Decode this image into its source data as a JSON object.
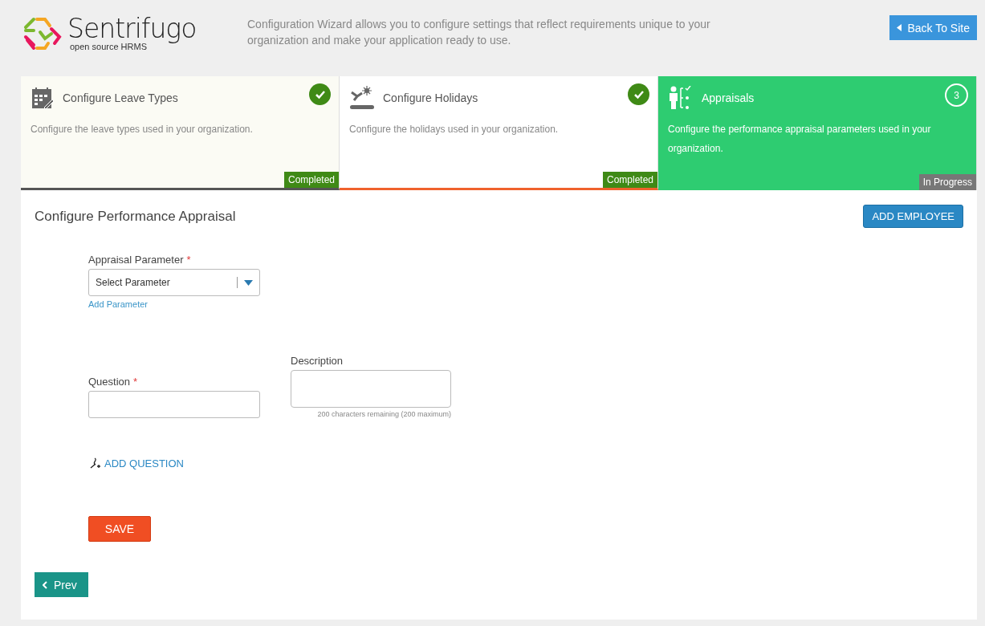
{
  "header": {
    "logo_name": "Sentrifugo",
    "logo_tagline": "open source HRMS",
    "intro": "Configuration Wizard allows you to configure settings that reflect requirements unique to your organization and make your application ready to use.",
    "back_button": "Back To Site"
  },
  "steps": [
    {
      "title": "Configure Leave Types",
      "description": "Configure the leave types used in your organization.",
      "status": "Completed",
      "kind": "completed",
      "color": "#555555",
      "selected": false
    },
    {
      "title": "Configure Holidays",
      "description": "Configure the holidays used in your organization.",
      "status": "Completed",
      "kind": "completed",
      "color": "#f0622d",
      "selected": false
    },
    {
      "title": "Appraisals",
      "description": "Configure the performance appraisal parameters used in your organization.",
      "status": "In Progress",
      "kind": "in_progress",
      "number": "3",
      "selected": true
    }
  ],
  "form": {
    "title": "Configure Performance Appraisal",
    "add_employee_button": "ADD EMPLOYEE",
    "parameter": {
      "label": "Appraisal Parameter",
      "required_mark": "*",
      "value": "Select Parameter",
      "link": "Add Parameter"
    },
    "question": {
      "label": "Question",
      "required_mark": "*"
    },
    "description": {
      "label": "Description",
      "hint": "200 characters remaining (200 maximum)"
    },
    "add_question": "ADD QUESTION",
    "save_button": "SAVE",
    "prev_button": "Prev"
  }
}
